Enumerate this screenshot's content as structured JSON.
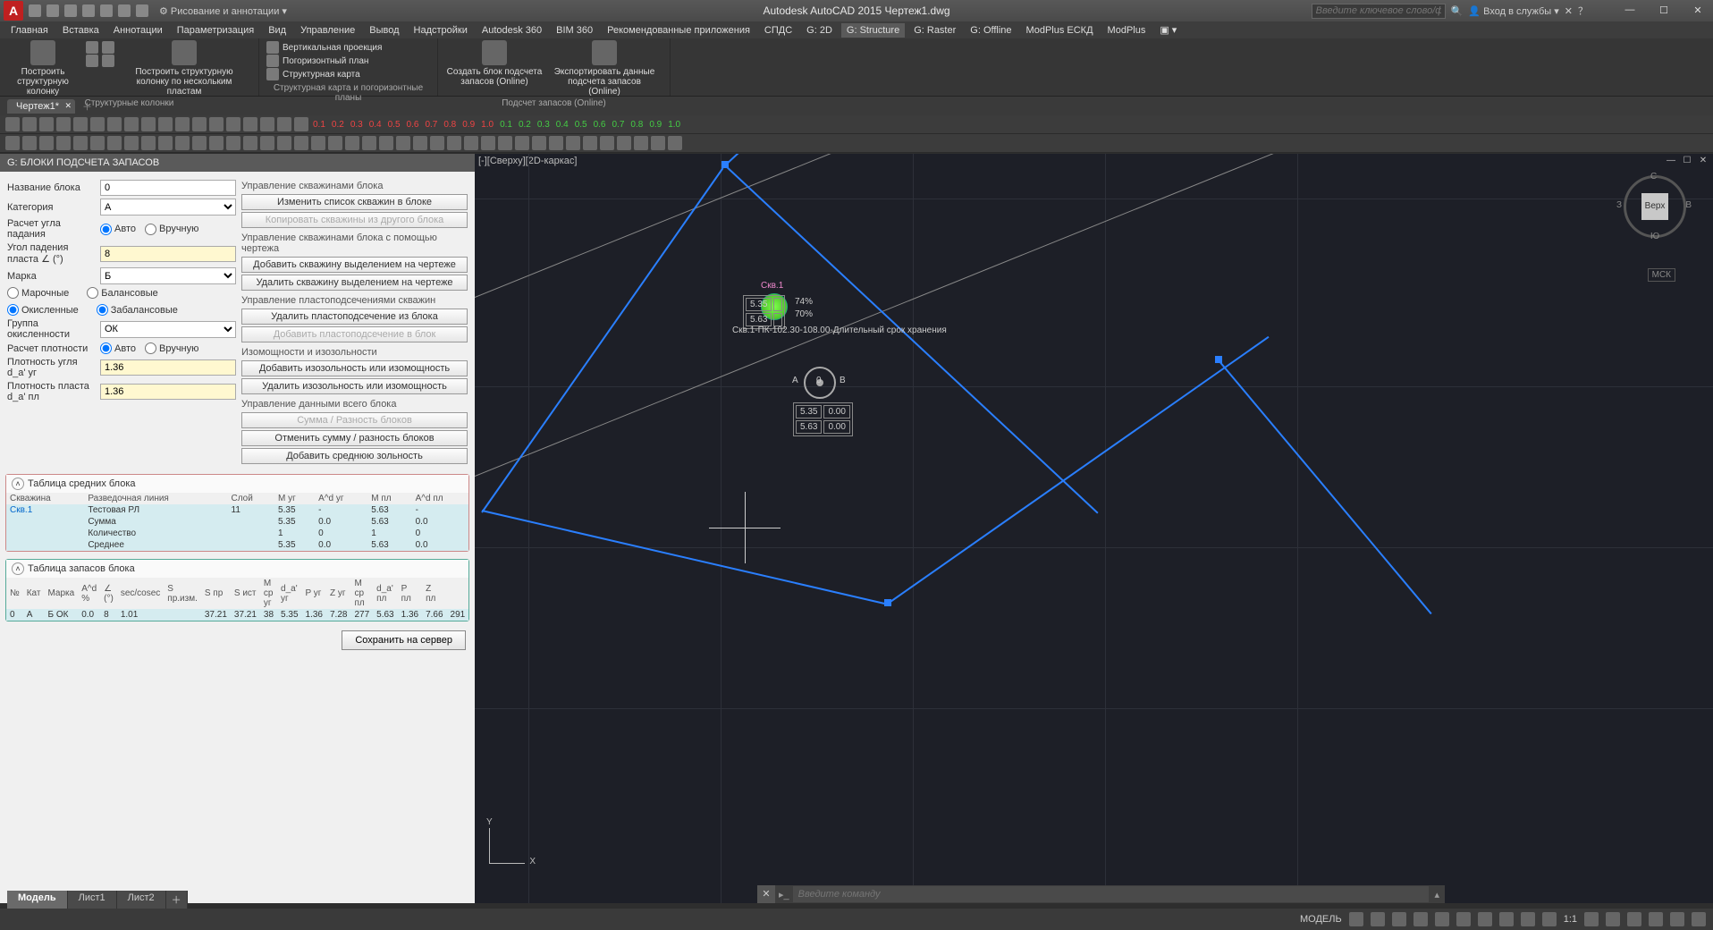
{
  "app": {
    "title": "Autodesk AutoCAD 2015     Чертеж1.dwg"
  },
  "qat_dropdown": "Рисование и аннотации",
  "search_placeholder": "Введите ключевое слово/фразу",
  "login_label": "Вход в службы",
  "menu": [
    "Главная",
    "Вставка",
    "Аннотации",
    "Параметризация",
    "Вид",
    "Управление",
    "Вывод",
    "Надстройки",
    "Autodesk 360",
    "BIM 360",
    "Рекомендованные приложения",
    "СПДС",
    "G: 2D",
    "G: Structure",
    "G: Raster",
    "G: Offline",
    "ModPlus ЕСКД",
    "ModPlus"
  ],
  "menu_active": "G: Structure",
  "ribbon": {
    "panel1": {
      "title": "Структурные колонки",
      "btn1": "Построить структурную колонку",
      "btn2": "Построить структурную колонку по нескольким пластам"
    },
    "panel2": {
      "title": "Структурная карта и погоризонтные планы",
      "r1": "Вертикальная проекция",
      "r2": "Погоризонтный план",
      "r3": "Структурная карта"
    },
    "panel3": {
      "title": "Подсчет запасов (Online)",
      "btn1": "Создать блок подсчета запасов (Online)",
      "btn2": "Экспортировать данные подсчета запасов (Online)"
    }
  },
  "filetab": "Чертеж1*",
  "ruler_vals": {
    "red": [
      "0.1",
      "0.2",
      "0.3",
      "0.4",
      "0.5",
      "0.6",
      "0.7",
      "0.8",
      "0.9",
      "1.0"
    ],
    "green": [
      "0.1",
      "0.2",
      "0.3",
      "0.4",
      "0.5",
      "0.6",
      "0.7",
      "0.8",
      "0.9",
      "1.0"
    ]
  },
  "dock": {
    "title": "G: БЛОКИ ПОДСЧЕТА ЗАПАСОВ",
    "name_label": "Название блока",
    "name_val": "0",
    "cat_label": "Категория",
    "cat_val": "A",
    "angle_calc": "Расчет угла падания",
    "auto": "Авто",
    "manual": "Вручную",
    "dip_label": "Угол падения пласта ∠ (°)",
    "dip_val": "8",
    "marka_label": "Марка",
    "marka_val": "Б",
    "t1": "Марочные",
    "t2": "Балансовые",
    "t3": "Окисленные",
    "t4": "Забалансовые",
    "oxgroup_label": "Группа окисленности",
    "oxgroup_val": "ОК",
    "dens_calc": "Расчет плотности",
    "dens_ug": "Плотность угля d_а' уг",
    "dens_ug_val": "1.36",
    "dens_pl": "Плотность пласта d_а' пл",
    "dens_pl_val": "1.36",
    "sec1": "Управление скважинами блока",
    "b1": "Изменить список скважин в блоке",
    "b2": "Копировать скважины из другого блока",
    "sec2": "Управление скважинами блока с помощью чертежа",
    "b3": "Добавить скважину выделением на чертеже",
    "b4": "Удалить скважину выделением на чертеже",
    "sec3": "Управление пластоподсечениями скважин",
    "b5": "Удалить пластоподсечение из блока",
    "b6": "Добавить пластоподсечение в блок",
    "sec4": "Изомощности и изозольности",
    "b7": "Добавить изозольность или изомощность",
    "b8": "Удалить изозольность или изомощность",
    "sec5": "Управление данными всего блока",
    "b9": "Сумма / Разность блоков",
    "b10": "Отменить сумму / разность блоков",
    "b11": "Добавить среднюю зольность",
    "tbl1_title": "Таблица средних блока",
    "tbl1_cols": [
      "Скважина",
      "Разведочная линия",
      "Слой",
      "M уг",
      "A^d уг",
      "M пл",
      "A^d пл"
    ],
    "tbl1_rows": [
      [
        "Скв.1",
        "Тестовая РЛ",
        "11",
        "5.35",
        "-",
        "5.63",
        "-"
      ],
      [
        "",
        "Сумма",
        "",
        "5.35",
        "0.0",
        "5.63",
        "0.0"
      ],
      [
        "",
        "Количество",
        "",
        "1",
        "0",
        "1",
        "0"
      ],
      [
        "",
        "Среднее",
        "",
        "5.35",
        "0.0",
        "5.63",
        "0.0"
      ]
    ],
    "tbl2_title": "Таблица запасов блока",
    "tbl2_cols": [
      "№",
      "Кат",
      "Марка",
      "A^d %",
      "∠ (°)",
      "sec/cosec",
      "S пр.изм.",
      "S пр",
      "S ист",
      "M ср уг",
      "d_а' уг",
      "P уг",
      "Z уг",
      "M ср пл",
      "d_а' пл",
      "P пл",
      "Z пл"
    ],
    "tbl2_rows": [
      [
        "0",
        "A",
        "Б ОК",
        "0.0",
        "8",
        "1.01",
        "",
        "37.21",
        "37.21",
        "38",
        "5.35",
        "1.36",
        "7.28",
        "277",
        "5.63",
        "1.36",
        "7.66",
        "291"
      ]
    ],
    "save": "Сохранить на сервер"
  },
  "viewport": {
    "label": "[-][Сверху][2D-каркас]",
    "well": "Скв.1",
    "well_pct1": "74%",
    "well_pct2": "70%",
    "well_v1": "5.35",
    "well_v2": "5.63",
    "well_long": "Скв.1-ПК-102.30-108.00-Длительный срок хранения",
    "center_vals": [
      [
        "5.35",
        "0.00"
      ],
      [
        "5.63",
        "0.00"
      ]
    ],
    "center_letters": [
      "A",
      "B"
    ],
    "center_num": "0",
    "cube": {
      "top": "Верх",
      "n": "С",
      "s": "Ю",
      "e": "В",
      "w": "З"
    },
    "wcs": "МСК"
  },
  "cmd_placeholder": "Введите команду",
  "layout_tabs": [
    "Модель",
    "Лист1",
    "Лист2"
  ],
  "status": {
    "model": "МОДЕЛЬ",
    "scale": "1:1"
  }
}
